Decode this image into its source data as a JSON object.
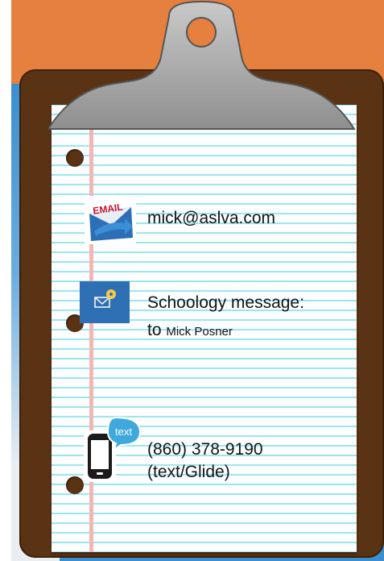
{
  "contacts": {
    "email": {
      "text": "mick@aslva.com",
      "icon": "email-envelope-icon"
    },
    "schoology": {
      "line1": "Schoology message:",
      "line2_prefix": "to ",
      "line2_name": "Mick Posner",
      "icon": "schoology-mail-icon"
    },
    "phone": {
      "number": "(860) 378-9190",
      "note": "(text/Glide)",
      "icon": "phone-text-icon"
    }
  },
  "icon_labels": {
    "email": "EMAIL",
    "phone": "text"
  },
  "colors": {
    "orange": "#e5803f",
    "blue": "#3a8fd0",
    "board": "#5a3214",
    "clip": "#a7a7a7",
    "paper_lines": "#9ee6ee",
    "margin": "#f2b7b5"
  }
}
